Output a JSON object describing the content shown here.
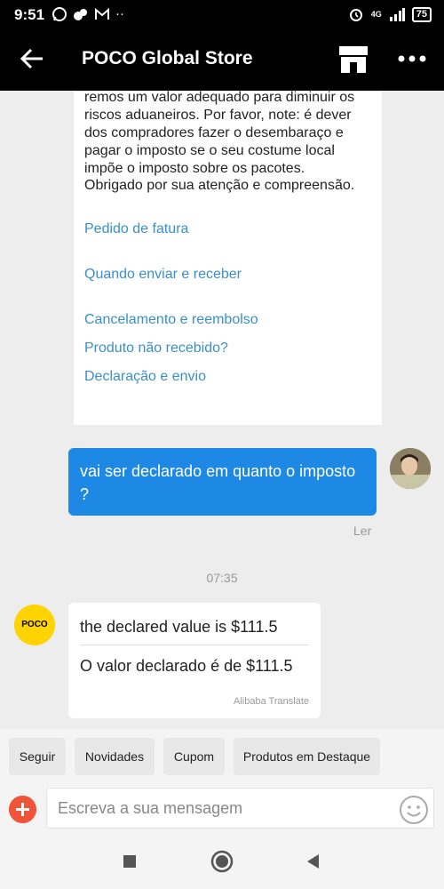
{
  "status_bar": {
    "time": "9:51",
    "network": "4G",
    "battery": "75"
  },
  "app_bar": {
    "title": "POCO Global Store"
  },
  "notice_card": {
    "paragraph": "remos um valor adequado para diminuir os riscos aduaneiros. Por favor, note: é dever dos compradores fazer o desembaraço e pagar o imposto se o seu costume local impõe o imposto sobre os pacotes.",
    "thanks": "Obrigado por sua atenção e compreensão.",
    "links": [
      "Pedido de fatura",
      "Quando enviar e receber",
      "Cancelamento e reembolso",
      "Produto não recebido?",
      "Declaração e envio"
    ]
  },
  "user_message": {
    "text": "vai ser declarado em quanto o imposto ?",
    "status": "Ler"
  },
  "time_separator": "07:35",
  "store_message": {
    "avatar_text": "POCO",
    "original": "the declared value is $111.5",
    "translated": "O valor declarado é de $111.5",
    "provider": "Alibaba Translate"
  },
  "quick_replies": [
    "Seguir",
    "Novidades",
    "Cupom",
    "Produtos em Destaque"
  ],
  "composer": {
    "placeholder": "Escreva a sua mensagem"
  }
}
